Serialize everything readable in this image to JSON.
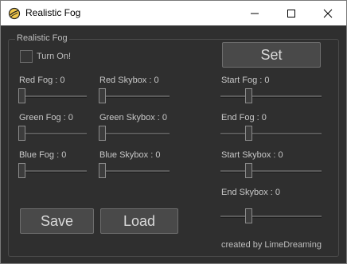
{
  "window": {
    "title": "Realistic Fog",
    "minimize_glyph": "—",
    "maximize_glyph": "☐",
    "close_glyph": "✕"
  },
  "group": {
    "title": "Realistic Fog",
    "checkbox_label": "Turn On!",
    "checkbox_checked": false
  },
  "buttons": {
    "set": "Set",
    "save": "Save",
    "load": "Load"
  },
  "sliders": {
    "red_fog": {
      "label": "Red Fog : 0",
      "value": 0
    },
    "red_skybox": {
      "label": "Red Skybox : 0",
      "value": 0
    },
    "green_fog": {
      "label": "Green Fog : 0",
      "value": 0
    },
    "green_skybox": {
      "label": "Green Skybox : 0",
      "value": 0
    },
    "blue_fog": {
      "label": "Blue Fog : 0",
      "value": 0
    },
    "blue_skybox": {
      "label": "Blue Skybox : 0",
      "value": 0
    },
    "start_fog": {
      "label": "Start Fog : 0"
    },
    "end_fog": {
      "label": "End Fog : 0"
    },
    "start_skybox": {
      "label": "Start Skybox : 0"
    },
    "end_skybox": {
      "label": "End Skybox : 0"
    }
  },
  "credit": "created by LimeDreaming",
  "colors": {
    "background": "#2f2f2f",
    "text": "#c8c8c8",
    "button": "#494949"
  }
}
